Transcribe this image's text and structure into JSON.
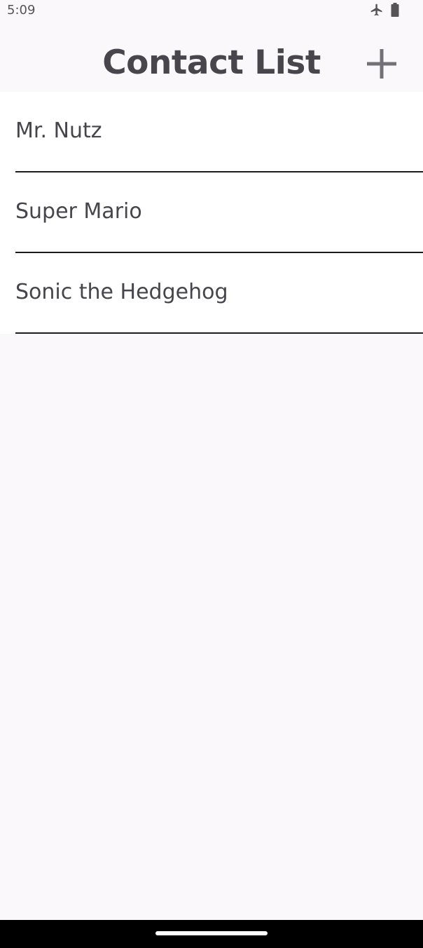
{
  "status_bar": {
    "time": "5:09",
    "icons": [
      "airplane-mode-icon",
      "battery-icon"
    ]
  },
  "app_bar": {
    "title": "Contact List",
    "add_icon": "plus-icon"
  },
  "contacts": [
    {
      "name": "Mr. Nutz"
    },
    {
      "name": "Super Mario"
    },
    {
      "name": "Sonic the Hedgehog"
    }
  ],
  "colors": {
    "background": "#fbf8fc",
    "list_background": "#ffffff",
    "text": "#46454b",
    "divider": "#1c1b1f",
    "icon": "#737177"
  }
}
